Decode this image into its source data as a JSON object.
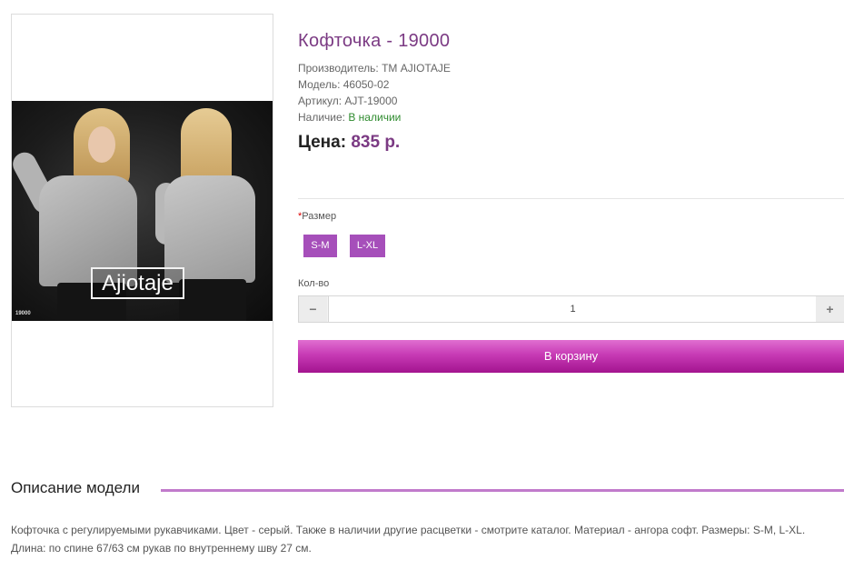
{
  "product": {
    "title": "Кофточка - 19000",
    "manufacturer": "Производитель: ТМ AJIOTAJE",
    "model": "Модель: 46050-02",
    "sku": "Артикул: AJT-19000",
    "availability_label": "Наличие: ",
    "availability_value": "В наличии",
    "price_label": "Цена:",
    "price_value": "835 р."
  },
  "image": {
    "logo_text": "Ajiotaje",
    "code": "19000"
  },
  "options": {
    "required_mark": "*",
    "size_label": "Размер",
    "sizes": [
      "S-M",
      "L-XL"
    ]
  },
  "quantity": {
    "label": "Кол-во",
    "value": "1",
    "minus": "−",
    "plus": "+"
  },
  "cart_button": "В корзину",
  "description": {
    "heading": "Описание модели",
    "text": "Кофточка с регулируемыми рукавчиками. Цвет - серый. Также в наличии другие расцветки - смотрите каталог. Материал - ангора софт. Размеры: S-M, L-XL. Длина: по спине 67/63 см рукав по внутреннему шву 27 см."
  },
  "colors": {
    "accent": "#7b3a83",
    "button": "#a64fba",
    "cart_gradient_top": "#e06fd0",
    "cart_gradient_bottom": "#a3148f",
    "in_stock": "#2e8b2e"
  }
}
